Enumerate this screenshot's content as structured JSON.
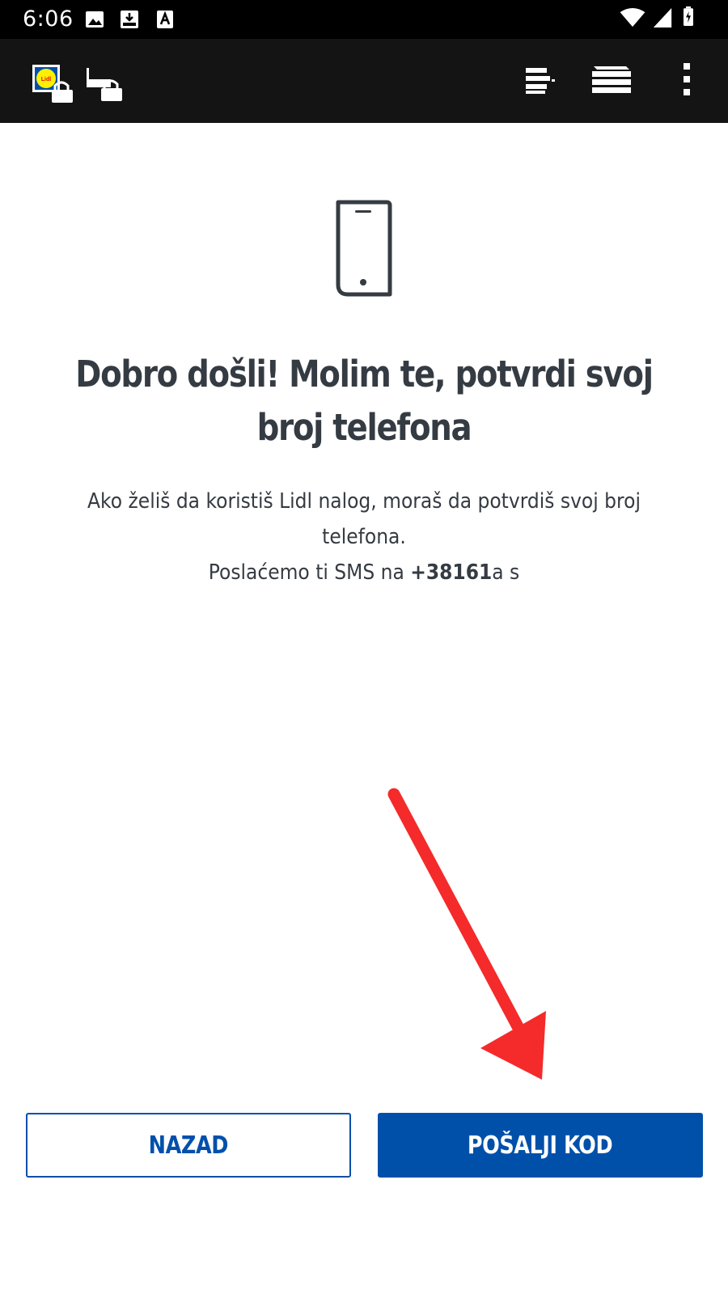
{
  "status_bar": {
    "time": "6:06",
    "icons": [
      "image-icon",
      "download-icon",
      "text-a-icon",
      "wifi-icon",
      "signal-icon",
      "battery-charging-icon"
    ]
  },
  "app_bar": {
    "icons": [
      "lidl-logo-lock-icon",
      "lock-tab-icon",
      "stack-icon",
      "menu-layers-icon",
      "more-vertical-icon"
    ]
  },
  "content": {
    "hero_icon": "smartphone-icon",
    "title": "Dobro došli! Molim te, potvrdi svoj broj telefona",
    "body_line1": "Ako želiš da koristiš Lidl nalog, moraš da potvrdiš svoj broj telefona.",
    "body_line2_prefix": "Poslaćemo ti SMS na ",
    "phone_number": "+38161",
    "body_line2_suffix": "a s"
  },
  "buttons": {
    "back_label": "NAZAD",
    "send_label": "POŠALJI KOD"
  },
  "annotation": {
    "arrow_color": "#f52a2a"
  },
  "colors": {
    "primary": "#0050aa",
    "text": "#353b42",
    "app_bar": "#141414",
    "status_bar": "#000000"
  }
}
